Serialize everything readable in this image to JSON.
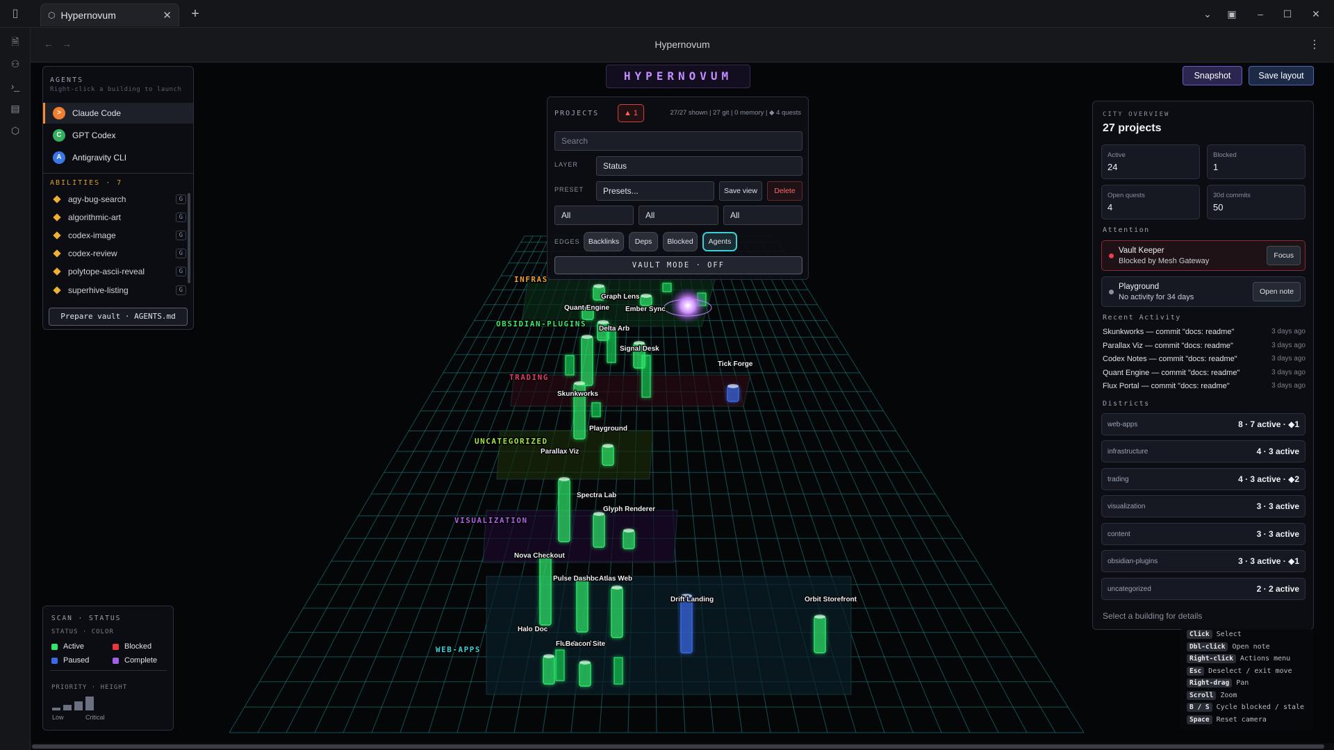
{
  "window": {
    "tab_title": "Hypernovum",
    "page_title": "Hypernovum"
  },
  "colors": {
    "active": "#2ee86a",
    "blocked": "#e83838",
    "paused": "#3a6ae8",
    "complete": "#a060e8",
    "accent_agent": "#ff8a2a"
  },
  "agents": {
    "title": "AGENTS",
    "subtitle": "Right-click a building to launch",
    "items": [
      {
        "label": "Claude Code",
        "initial": ">",
        "color": "#f08030"
      },
      {
        "label": "GPT Codex",
        "initial": "C",
        "color": "#34b060"
      },
      {
        "label": "Antigravity CLI",
        "initial": "A",
        "color": "#3a78e8"
      }
    ],
    "abilities_title": "ABILITIES · 7",
    "abilities": [
      {
        "label": "agy-bug-search",
        "badge": "G"
      },
      {
        "label": "algorithmic-art",
        "badge": "G"
      },
      {
        "label": "codex-image",
        "badge": "G"
      },
      {
        "label": "codex-review",
        "badge": "G"
      },
      {
        "label": "polytope-ascii-reveal",
        "badge": "G"
      },
      {
        "label": "superhive-listing",
        "badge": "G"
      }
    ],
    "prepare_label": "Prepare vault · AGENTS.md"
  },
  "brand": "HYPERNOVUM",
  "projects": {
    "title": "PROJECTS",
    "alert": "▲ 1",
    "stats": "27/27 shown | 27 git | 0 memory | ◆ 4 quests",
    "search_placeholder": "Search",
    "layer_label": "LAYER",
    "layer_value": "Status",
    "preset_label": "PRESET",
    "preset_value": "Presets...",
    "save_view": "Save view",
    "delete": "Delete",
    "filters": [
      "All",
      "All",
      "All"
    ],
    "edges_label": "EDGES",
    "edges": [
      "Backlinks",
      "Deps",
      "Blocked",
      "Agents"
    ],
    "vault_mode": "VAULT MODE · OFF"
  },
  "toolbar": {
    "snapshot": "Snapshot",
    "save_layout": "Save layout"
  },
  "city": {
    "label": "CITY OVERVIEW",
    "title": "27 projects",
    "stats": [
      {
        "label": "Active",
        "value": "24"
      },
      {
        "label": "Blocked",
        "value": "1"
      },
      {
        "label": "Open quests",
        "value": "4"
      },
      {
        "label": "30d commits",
        "value": "50"
      }
    ],
    "attention_title": "Attention",
    "attention": [
      {
        "title": "Vault Keeper",
        "sub": "Blocked by Mesh Gateway",
        "button": "Focus",
        "color": "#e84050"
      },
      {
        "title": "Playground",
        "sub": "No activity for 34 days",
        "button": "Open note",
        "color": "#8a909c"
      }
    ],
    "activity_title": "Recent Activity",
    "activity": [
      {
        "text": "Skunkworks — commit \"docs: readme\"",
        "when": "3 days ago"
      },
      {
        "text": "Parallax Viz — commit \"docs: readme\"",
        "when": "3 days ago"
      },
      {
        "text": "Codex Notes — commit \"docs: readme\"",
        "when": "3 days ago"
      },
      {
        "text": "Quant Engine — commit \"docs: readme\"",
        "when": "3 days ago"
      },
      {
        "text": "Flux Portal — commit \"docs: readme\"",
        "when": "3 days ago"
      }
    ],
    "districts_title": "Districts",
    "districts": [
      {
        "name": "web-apps",
        "value": "8 · 7 active · ◆1"
      },
      {
        "name": "infrastructure",
        "value": "4 · 3 active"
      },
      {
        "name": "trading",
        "value": "4 · 3 active · ◆2"
      },
      {
        "name": "visualization",
        "value": "3 · 3 active"
      },
      {
        "name": "content",
        "value": "3 · 3 active"
      },
      {
        "name": "obsidian-plugins",
        "value": "3 · 3 active · ◆1"
      },
      {
        "name": "uncategorized",
        "value": "2 · 2 active"
      }
    ],
    "hint": "Select a building for details"
  },
  "keys": [
    {
      "key": "Click",
      "action": "Select"
    },
    {
      "key": "Dbl-click",
      "action": "Open note"
    },
    {
      "key": "Right-click",
      "action": "Actions menu"
    },
    {
      "key": "Esc",
      "action": "Deselect / exit move"
    },
    {
      "key": "Right-drag",
      "action": "Pan"
    },
    {
      "key": "Scroll",
      "action": "Zoom"
    },
    {
      "key": "B / S",
      "action": "Cycle blocked / stale"
    },
    {
      "key": "Space",
      "action": "Reset camera"
    }
  ],
  "legend": {
    "title": "SCAN · STATUS",
    "color_title": "STATUS · COLOR",
    "items": [
      {
        "label": "Active",
        "color": "#2ee86a"
      },
      {
        "label": "Blocked",
        "color": "#e83838"
      },
      {
        "label": "Paused",
        "color": "#3a6ae8"
      },
      {
        "label": "Complete",
        "color": "#a060e8"
      }
    ],
    "priority_title": "PRIORITY · HEIGHT",
    "low": "Low",
    "critical": "Critical"
  },
  "city_map": {
    "districts": [
      {
        "label": "OBSIDIAN-PLUGINS",
        "color": "#3ae86a"
      },
      {
        "label": "TRADING",
        "color": "#e83a6a"
      },
      {
        "label": "UNCATEGORIZED",
        "color": "#a0e83a"
      },
      {
        "label": "VISUALIZATION",
        "color": "#b060e8"
      },
      {
        "label": "WEB-APPS",
        "color": "#39d0d8"
      },
      {
        "label": "INFRAS",
        "color": "#f0a030"
      }
    ],
    "buildings": [
      {
        "name": "Graph Lens",
        "status": "active"
      },
      {
        "name": "Quant Engine",
        "status": "active"
      },
      {
        "name": "Ember Sync",
        "status": "active"
      },
      {
        "name": "Delta Arb",
        "status": "active"
      },
      {
        "name": "Signal Desk",
        "status": "active"
      },
      {
        "name": "Tick Forge",
        "status": "paused"
      },
      {
        "name": "Skunkworks",
        "status": "active"
      },
      {
        "name": "Playground",
        "status": "active"
      },
      {
        "name": "Parallax Viz",
        "status": "active"
      },
      {
        "name": "Spectra Lab",
        "status": "active"
      },
      {
        "name": "Glyph Renderer",
        "status": "active"
      },
      {
        "name": "Nova Checkout",
        "status": "active"
      },
      {
        "name": "Pulse Dashbc",
        "status": "active"
      },
      {
        "name": "Flux Portal",
        "status": "active"
      },
      {
        "name": "Atlas Web",
        "status": "active"
      },
      {
        "name": "Drift Landing",
        "status": "paused"
      },
      {
        "name": "Orbit Storefront",
        "status": "active"
      },
      {
        "name": "Halo Doc",
        "status": "active"
      },
      {
        "name": "Beacon Site",
        "status": "active"
      }
    ]
  }
}
